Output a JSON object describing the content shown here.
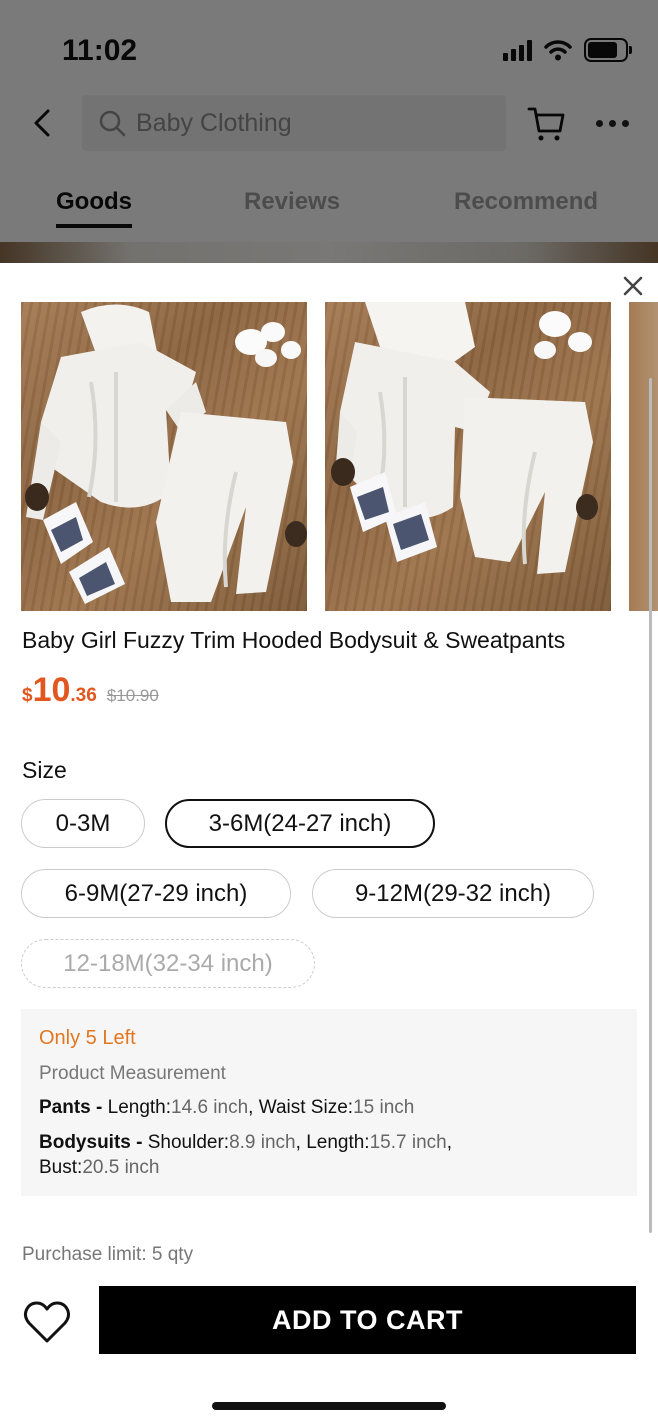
{
  "status_bar": {
    "time": "11:02"
  },
  "header": {
    "search_text": "Baby Clothing",
    "tabs": [
      {
        "label": "Goods",
        "active": true
      },
      {
        "label": "Reviews",
        "active": false
      },
      {
        "label": "Recommend",
        "active": false
      }
    ]
  },
  "product": {
    "title": "Baby Girl Fuzzy Trim Hooded Bodysuit & Sweatpants",
    "price": {
      "currency": "$",
      "integer": "10",
      "decimal": ".36",
      "original": "$10.90"
    },
    "accent_color": "#e2561f"
  },
  "size": {
    "label": "Size",
    "options": [
      {
        "label": "0-3M",
        "state": "normal"
      },
      {
        "label": "3-6M(24-27 inch)",
        "state": "selected"
      },
      {
        "label": "6-9M(27-29 inch)",
        "state": "normal"
      },
      {
        "label": "9-12M(29-32 inch)",
        "state": "normal"
      },
      {
        "label": "12-18M(32-34 inch)",
        "state": "disabled"
      }
    ]
  },
  "info": {
    "stock": "Only 5 Left",
    "measurement_title": "Product Measurement",
    "pants": {
      "name": "Pants -",
      "length_label": "Length:",
      "length_value": "14.6 inch",
      "sep": ",",
      "waist_label": "Waist Size:",
      "waist_value": "15 inch"
    },
    "bodysuits": {
      "name": "Bodysuits -",
      "shoulder_label": "Shoulder:",
      "shoulder_value": "8.9 inch",
      "sep1": ",",
      "length_label": "Length:",
      "length_value": "15.7 inch",
      "sep2": ",",
      "bust_label": "Bust:",
      "bust_value": "20.5 inch"
    }
  },
  "footer": {
    "purchase_limit": "Purchase limit: 5 qty",
    "add_to_cart": "ADD TO CART"
  }
}
